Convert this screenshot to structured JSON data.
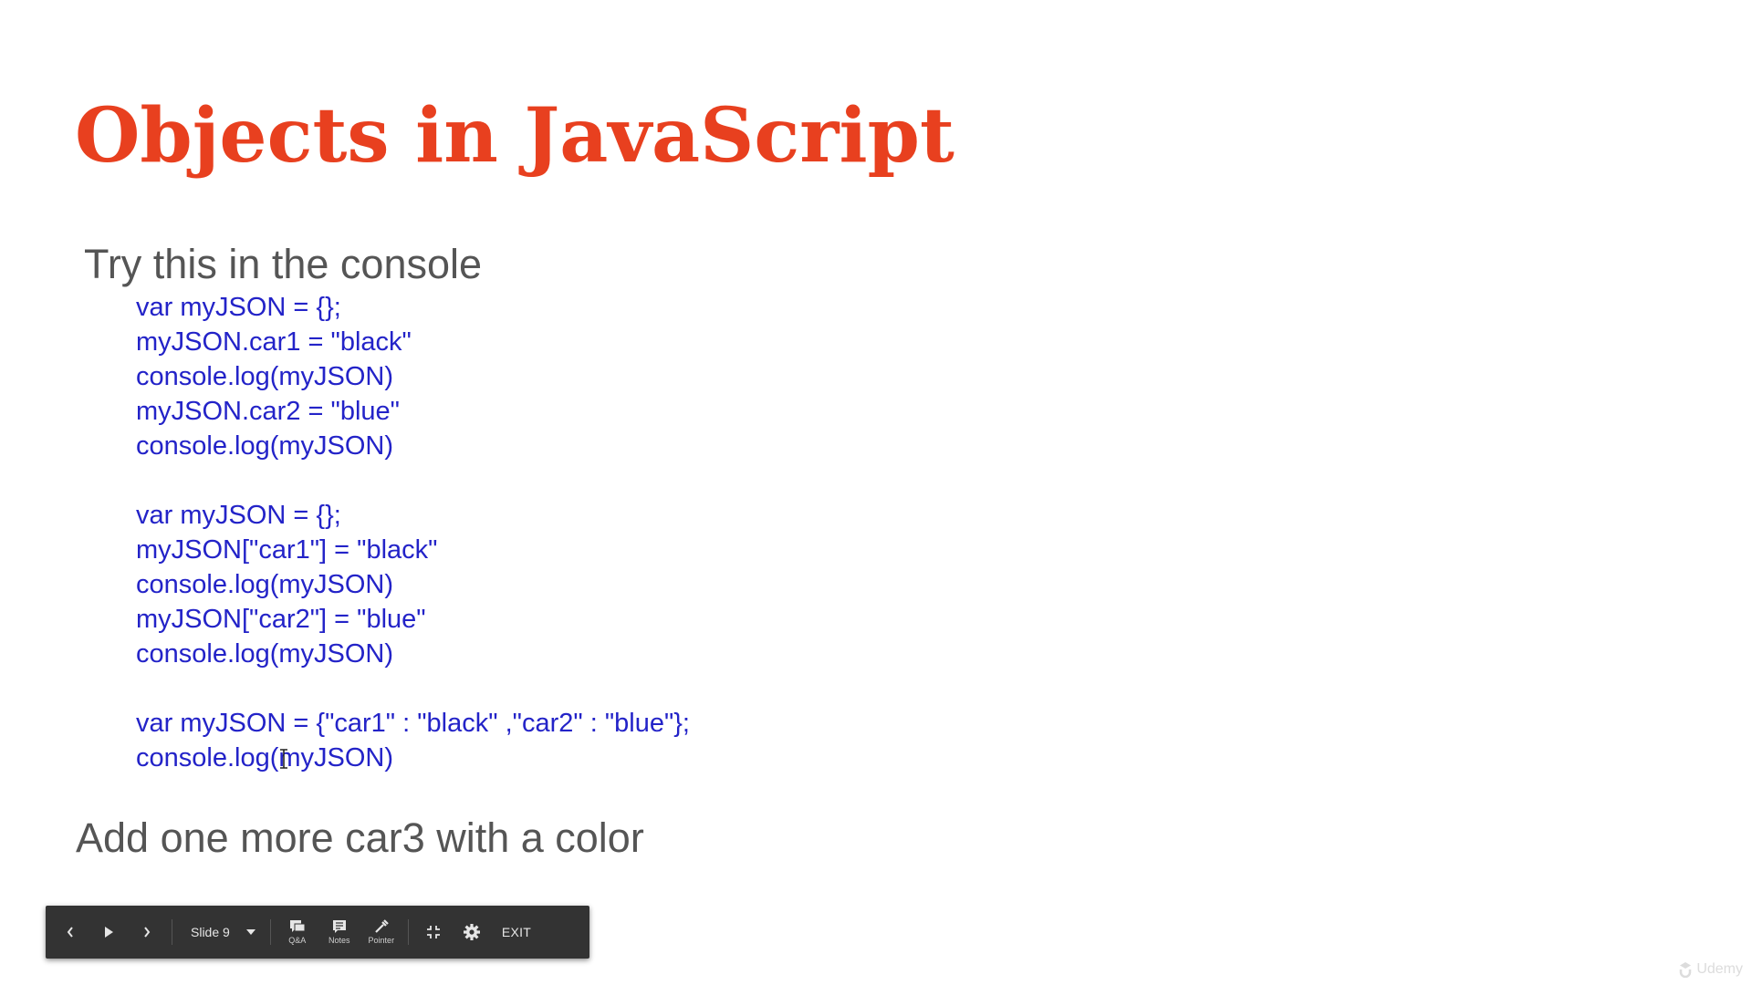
{
  "slide": {
    "title": "Objects in JavaScript",
    "intro": "Try this in the console",
    "code_lines": [
      "var myJSON = {};",
      "myJSON.car1 = \"black\"",
      "console.log(myJSON)",
      "myJSON.car2 = \"blue\"",
      "console.log(myJSON)",
      "",
      "var myJSON = {};",
      "myJSON[\"car1\"] = \"black\"",
      "console.log(myJSON)",
      "myJSON[\"car2\"] = \"blue\"",
      "console.log(myJSON)",
      "",
      "var myJSON = {\"car1\" : \"black\" ,\"car2\" : \"blue\"};",
      "console.log(myJSON)"
    ],
    "outro": "Add one more car3 with a color",
    "colors": {
      "title": "#e8401f",
      "code": "#2323c8",
      "body_text": "#555555"
    }
  },
  "toolbar": {
    "prev_icon": "chevron-left-icon",
    "play_icon": "play-icon",
    "next_icon": "chevron-right-icon",
    "slide_select": "Slide 9",
    "dropdown_icon": "caret-down-icon",
    "qa_label": "Q&A",
    "notes_label": "Notes",
    "pointer_label": "Pointer",
    "fullscreen_exit_icon": "exit-fullscreen-icon",
    "settings_icon": "gear-icon",
    "exit_label": "EXIT",
    "background": "#333333"
  },
  "watermark": {
    "text": "Udemy"
  }
}
